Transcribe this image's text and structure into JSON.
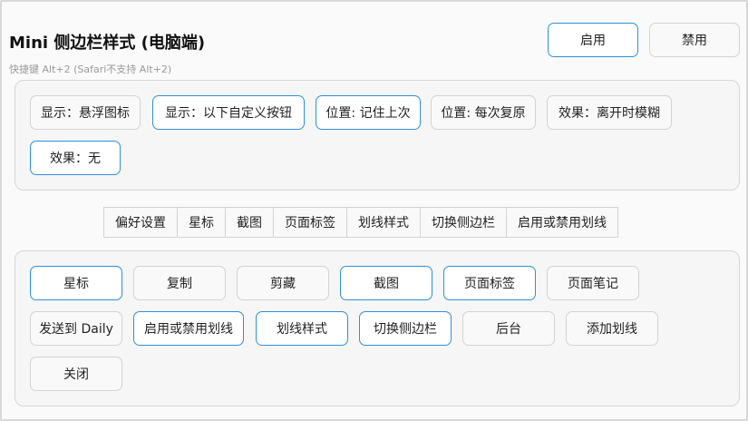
{
  "header": {
    "title": "Mini 侧边栏样式 (电脑端)",
    "shortcut_hint": "快捷键 Alt+2 (Safari不支持 Alt+2)",
    "enable_label": "启用",
    "disable_label": "禁用"
  },
  "options": [
    {
      "label": "显示：悬浮图标",
      "active": false
    },
    {
      "label": "显示：以下自定义按钮",
      "active": true
    },
    {
      "label": "位置: 记住上次",
      "active": true
    },
    {
      "label": "位置: 每次复原",
      "active": false
    },
    {
      "label": "效果：离开时模糊",
      "active": false
    },
    {
      "label": "效果：无",
      "active": true
    }
  ],
  "tabs": [
    "偏好设置",
    "星标",
    "截图",
    "页面标签",
    "划线样式",
    "切换侧边栏",
    "启用或禁用划线"
  ],
  "buttons": [
    {
      "label": "星标",
      "active": true
    },
    {
      "label": "复制",
      "active": false
    },
    {
      "label": "剪藏",
      "active": false
    },
    {
      "label": "截图",
      "active": true
    },
    {
      "label": "页面标签",
      "active": true
    },
    {
      "label": "页面笔记",
      "active": false
    },
    {
      "label": "发送到 Daily",
      "active": false
    },
    {
      "label": "启用或禁用划线",
      "active": true
    },
    {
      "label": "划线样式",
      "active": true
    },
    {
      "label": "切换侧边栏",
      "active": true
    },
    {
      "label": "后台",
      "active": false
    },
    {
      "label": "添加划线",
      "active": false
    },
    {
      "label": "关闭",
      "active": false
    }
  ]
}
